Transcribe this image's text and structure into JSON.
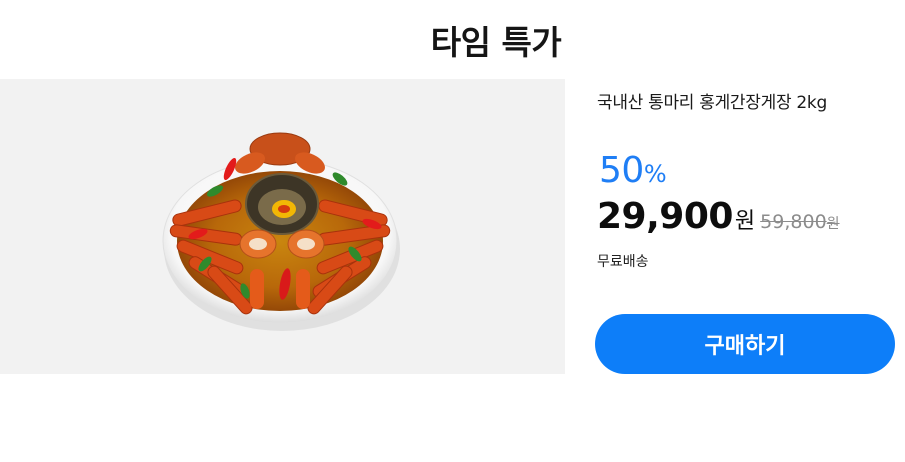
{
  "header": {
    "title": "타임 특가"
  },
  "product": {
    "image_icon": "marinated-crab-dish",
    "name": "국내산 통마리 홍게간장게장 2kg",
    "discount": {
      "value": "50",
      "unit": "%"
    },
    "price": {
      "sale": "29,900",
      "sale_unit": "원",
      "original": "59,800",
      "original_unit": "원"
    },
    "shipping": "무료배송"
  },
  "actions": {
    "buy_label": "구매하기"
  },
  "colors": {
    "accent": "#0d7ef9",
    "discount": "#1f7ef5",
    "image_background": "#f2f2f2",
    "original_price": "#8c8c8c"
  }
}
